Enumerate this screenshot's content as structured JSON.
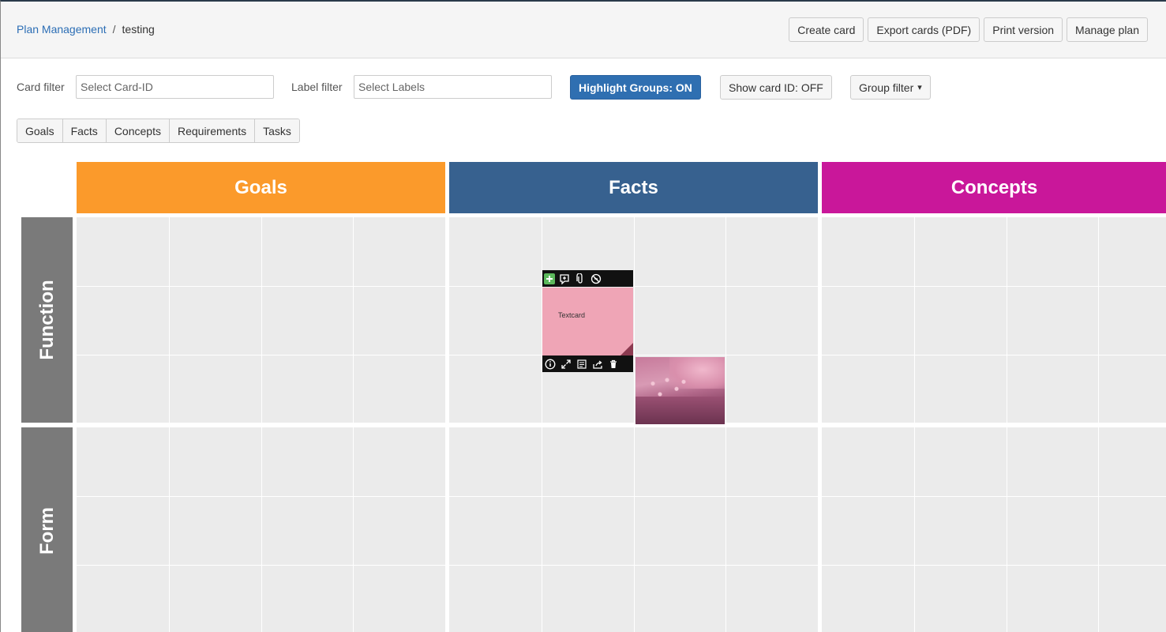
{
  "breadcrumb": {
    "root": "Plan Management",
    "separator": "/",
    "current": "testing"
  },
  "top_actions": {
    "create_card": "Create card",
    "export_cards": "Export cards (PDF)",
    "print_version": "Print version",
    "manage_plan": "Manage plan"
  },
  "filters": {
    "card_filter_label": "Card filter",
    "card_filter_placeholder": "Select Card-ID",
    "label_filter_label": "Label filter",
    "label_filter_placeholder": "Select Labels",
    "highlight_groups": "Highlight Groups: ON",
    "show_card_id": "Show card ID: OFF",
    "group_filter": "Group filter",
    "group_filter_caret": "▾"
  },
  "tabs": [
    "Goals",
    "Facts",
    "Concepts",
    "Requirements",
    "Tasks"
  ],
  "columns": [
    {
      "label": "Goals",
      "color": "#fb9a2b"
    },
    {
      "label": "Facts",
      "color": "#37618f"
    },
    {
      "label": "Concepts",
      "color": "#c9179a"
    }
  ],
  "rows": [
    {
      "label": "Function"
    },
    {
      "label": "Form"
    }
  ],
  "card": {
    "text": "Textcard",
    "top_tools": [
      "add-icon",
      "add-comment-icon",
      "attachment-icon",
      "no-link-icon"
    ],
    "bottom_tools": [
      "info-icon",
      "expand-icon",
      "details-icon",
      "share-icon",
      "trash-icon"
    ]
  },
  "colors": {
    "grid_cell": "#ebebeb",
    "row_header": "#7a7a7a",
    "primary_button": "#2f6fb1",
    "card": "#efa5b6",
    "add_icon": "#5cb85c"
  }
}
